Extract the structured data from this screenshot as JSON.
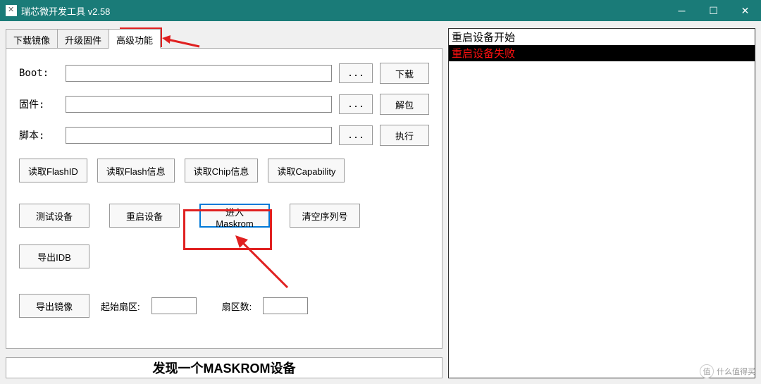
{
  "window": {
    "title": "瑞芯微开发工具 v2.58"
  },
  "tabs": {
    "download": "下载镜像",
    "upgrade": "升级固件",
    "advanced": "高级功能"
  },
  "form": {
    "boot_label": "Boot:",
    "firmware_label": "固件:",
    "script_label": "脚本:",
    "browse": "...",
    "download": "下载",
    "unpack": "解包",
    "execute": "执行"
  },
  "buttons_row1": {
    "read_flashid": "读取FlashID",
    "read_flash_info": "读取Flash信息",
    "read_chip_info": "读取Chip信息",
    "read_capability": "读取Capability"
  },
  "buttons_row2": {
    "test_device": "测试设备",
    "reboot_device": "重启设备",
    "enter_maskrom": "进入Maskrom",
    "clear_serial": "清空序列号"
  },
  "buttons_row3": {
    "export_idb": "导出IDB"
  },
  "bottom": {
    "export_image": "导出镜像",
    "start_sector": "起始扇区:",
    "sector_count": "扇区数:"
  },
  "status": "发现一个MASKROM设备",
  "log": {
    "line1": "重启设备开始",
    "line2": "重启设备失败"
  },
  "watermark": "什么值得买"
}
